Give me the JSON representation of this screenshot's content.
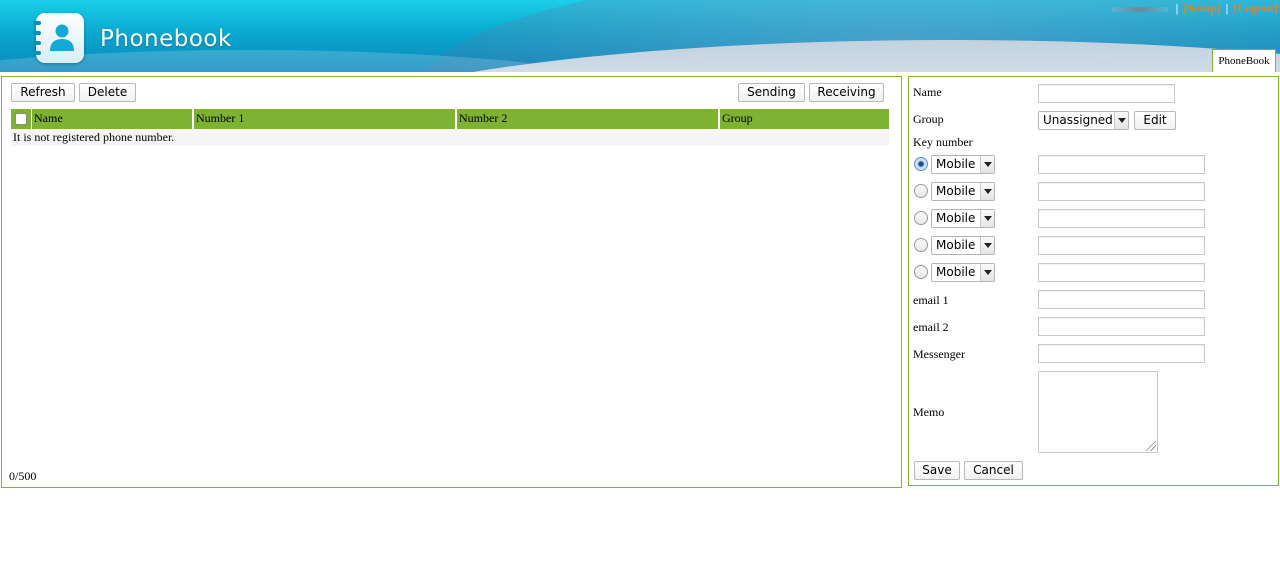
{
  "header": {
    "app_title": "Phonebook",
    "links": {
      "setup": "[Setup]",
      "logout": "[Logout]",
      "separator": "|"
    },
    "tab_label": "PhoneBook"
  },
  "toolbar": {
    "refresh": "Refresh",
    "delete": "Delete",
    "sending": "Sending",
    "receiving": "Receiving"
  },
  "table": {
    "columns": [
      "Name",
      "Number 1",
      "Number 2",
      "Group"
    ],
    "empty_message": "It is not registered phone number."
  },
  "counter": "0/500",
  "form": {
    "name_label": "Name",
    "group_label": "Group",
    "group_value": "Unassigned",
    "edit_button": "Edit",
    "key_number_label": "Key number",
    "number_type_default": "Mobile",
    "number_rows": 5,
    "selected_key_index": 0,
    "email1_label": "email 1",
    "email2_label": "email 2",
    "messenger_label": "Messenger",
    "memo_label": "Memo",
    "save_button": "Save",
    "cancel_button": "Cancel"
  },
  "colors": {
    "accent_green": "#7db233",
    "link_orange": "#e8821e",
    "header_cyan": "#0aa9cf"
  }
}
